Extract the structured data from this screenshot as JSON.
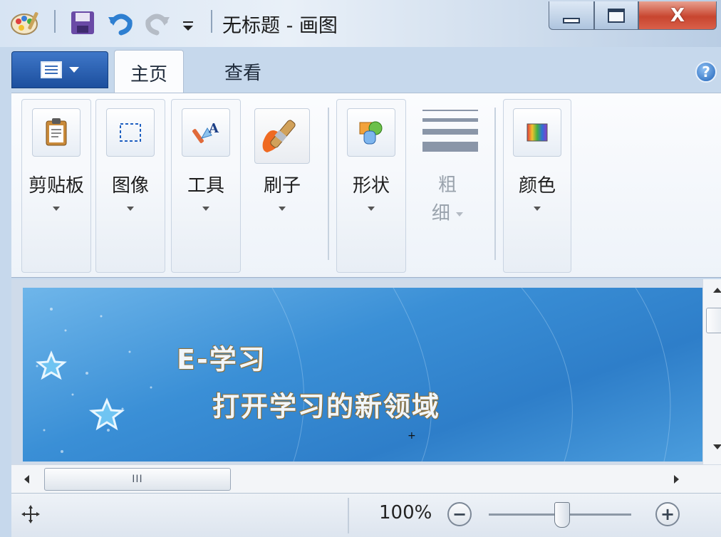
{
  "window": {
    "title": "无标题 - 画图",
    "controls": {
      "minimize_icon": "window-minimize-icon",
      "maximize_icon": "window-maximize-icon",
      "close_label": "X"
    }
  },
  "quick_access": {
    "icons": [
      "paint-app-icon",
      "save-icon",
      "undo-icon",
      "redo-icon",
      "customize-dropdown-icon"
    ]
  },
  "ribbon": {
    "tabs": [
      {
        "label": "主页",
        "active": true
      },
      {
        "label": "查看",
        "active": false
      }
    ],
    "groups": {
      "clipboard": "剪贴板",
      "image": "图像",
      "tools": "工具",
      "brushes": "刷子",
      "shapes": "形状",
      "thickness_line1": "粗",
      "thickness_line2": "细",
      "colors": "颜色"
    },
    "help_label": "?"
  },
  "canvas": {
    "line1": "E-学习",
    "line2": "打开学习的新领域"
  },
  "scrollbars": {
    "hthumb_grip": "III"
  },
  "statusbar": {
    "zoom": "100%",
    "zoom_level_percent": 100,
    "zoom_out_label": "−",
    "zoom_in_label": "+"
  }
}
